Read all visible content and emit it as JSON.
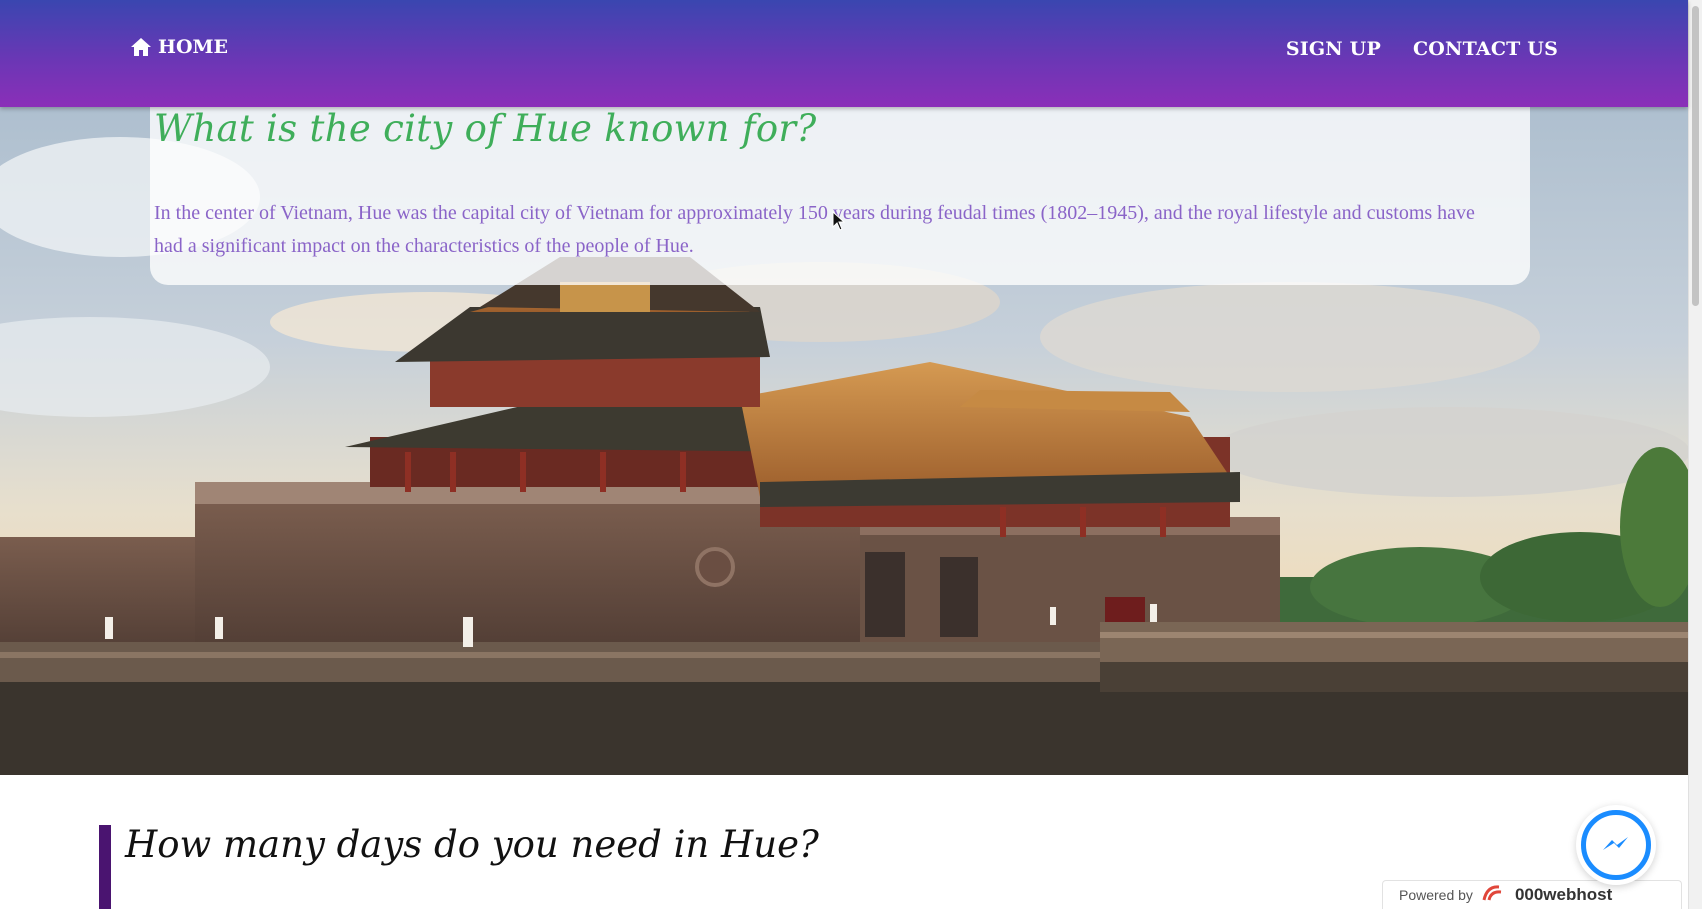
{
  "nav": {
    "home_label": "HOME",
    "home_icon": "house-icon",
    "links": [
      {
        "label": "SIGN UP"
      },
      {
        "label": "CONTACT US"
      }
    ],
    "gradient_top": "#3a46b0",
    "gradient_bottom": "#8b2fb8"
  },
  "intro": {
    "title": "What is the city of Hue known for?",
    "text": "In the center of Vietnam, Hue was the capital city of Vietnam for approximately 150 years during feudal times (1802–1945), and the royal lifestyle and customs have had a significant impact on the characteristics of the people of Hue.",
    "title_color": "#3fae5a",
    "text_color": "#8a64c8"
  },
  "hero": {
    "image": "imperial-citadel-gate-icon"
  },
  "section2": {
    "title": "How many days do you need in Hue?",
    "accent_color": "#4a1470"
  },
  "widgets": {
    "messenger_icon": "messenger-icon",
    "powered_label": "Powered by",
    "powered_brand": "000webhost"
  }
}
